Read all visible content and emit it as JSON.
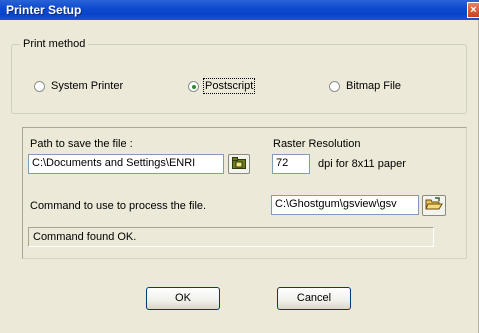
{
  "window": {
    "title": "Printer Setup",
    "close_glyph": "×"
  },
  "print_method": {
    "legend": "Print method",
    "options": [
      {
        "label": "System Printer",
        "selected": false
      },
      {
        "label": "Postscript",
        "selected": true
      },
      {
        "label": "Bitmap File",
        "selected": false
      }
    ]
  },
  "file": {
    "path_label": "Path to save the file :",
    "path_value": "C:\\Documents and Settings\\ENRI",
    "raster_label": "Raster Resolution",
    "raster_value": "72",
    "raster_unit": "dpi for 8x11 paper",
    "command_label": "Command to use to process the file.",
    "command_value": "C:\\Ghostgum\\gsview\\gsv",
    "status": "Command found OK."
  },
  "buttons": {
    "ok": "OK",
    "cancel": "Cancel"
  },
  "icons": {
    "path_browse": "folder-icon",
    "command_browse": "open-folder-icon"
  }
}
